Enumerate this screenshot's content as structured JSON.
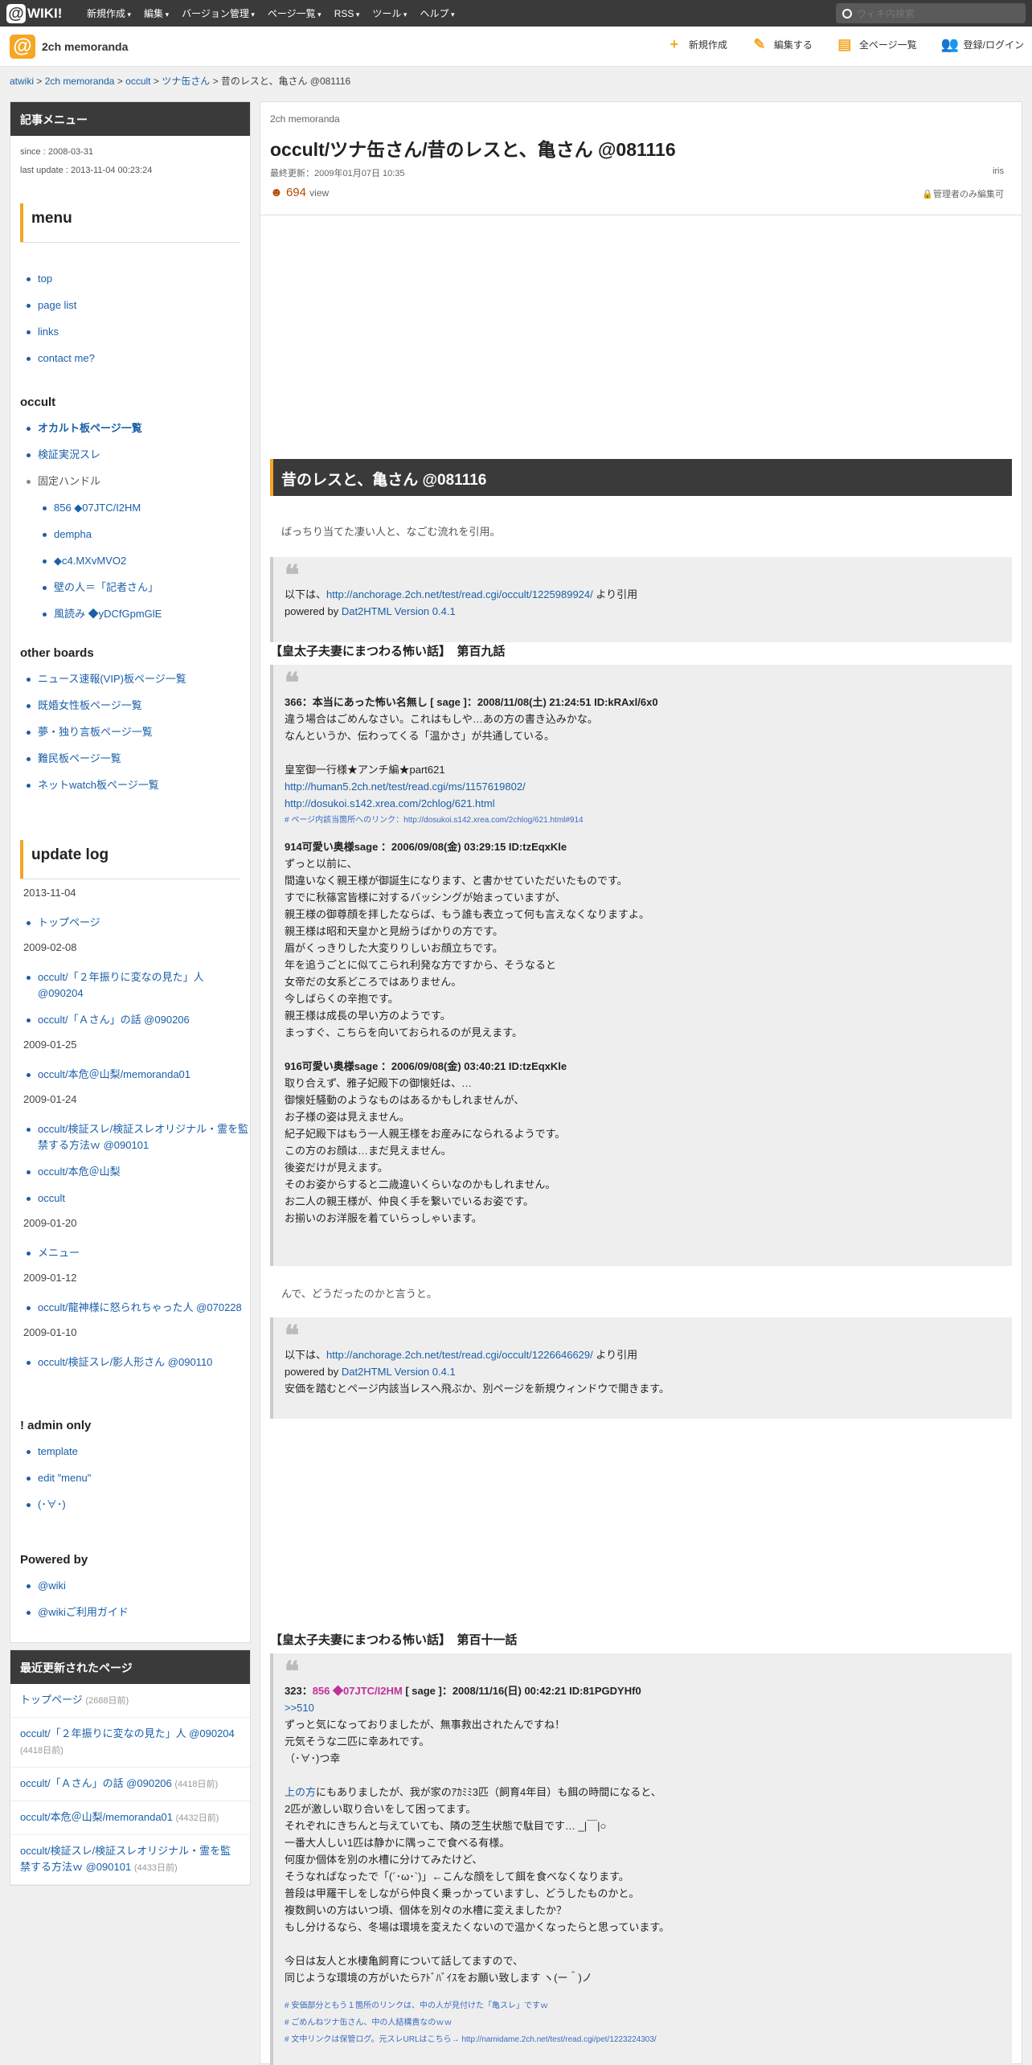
{
  "topbar": {
    "logo": "WIKI!",
    "menu": [
      "新規作成",
      "編集",
      "バージョン管理",
      "ページ一覧",
      "RSS",
      "ツール",
      "ヘルプ"
    ],
    "search_placeholder": "ウィキ内検索"
  },
  "header": {
    "site_name": "2ch memoranda",
    "actions": [
      "新規作成",
      "編集する",
      "全ページ一覧",
      "登録/ログイン"
    ]
  },
  "breadcrumb": {
    "items": [
      "atwiki",
      "2ch memoranda",
      "occult",
      "ツナ缶さん"
    ],
    "current": "昔のレスと、亀さん @081116",
    "sep": ">"
  },
  "sidebar": {
    "title": "記事メニュー",
    "since": "since : 2008-03-31",
    "last_update": "last update : 2013-11-04 00:23:24",
    "menu_title": "menu",
    "menu_items": [
      "top",
      "page list",
      "links",
      "contact me?"
    ],
    "occult_title": "occult",
    "occult_items": [
      "オカルト板ページ一覧",
      "検証実況スレ"
    ],
    "handles_title": "固定ハンドル",
    "handles": [
      "856 ◆07JTC/I2HM",
      "dempha",
      "◆c4.MXvMVO2",
      "壁の人＝「記者さん」",
      "風読み ◆yDCfGpmGlE"
    ],
    "other_title": "other boards",
    "other_items": [
      "ニュース速報(VIP)板ページ一覧",
      "既婚女性板ページ一覧",
      "夢・独り言板ページ一覧",
      "難民板ページ一覧",
      "ネットwatch板ページ一覧"
    ],
    "update_title": "update log",
    "updates": [
      {
        "date": "2013-11-04",
        "items": [
          "トップページ"
        ]
      },
      {
        "date": "2009-02-08",
        "items": [
          "occult/「２年振りに変なの見た」人 @090204",
          "occult/「Ａさん」の話 @090206"
        ]
      },
      {
        "date": "2009-01-25",
        "items": [
          "occult/本危＠山梨/memoranda01"
        ]
      },
      {
        "date": "2009-01-24",
        "items": [
          "occult/検証スレ/検証スレオリジナル・霊を監禁する方法ｗ @090101",
          "occult/本危＠山梨",
          "occult"
        ]
      },
      {
        "date": "2009-01-20",
        "items": [
          "メニュー"
        ]
      },
      {
        "date": "2009-01-12",
        "items": [
          "occult/龍神様に怒られちゃった人 @070228"
        ]
      },
      {
        "date": "2009-01-10",
        "items": [
          "occult/検証スレ/影人形さん @090110"
        ]
      }
    ],
    "admin_title": "! admin only",
    "admin_items": [
      "template",
      "edit \"menu\"",
      "(･∀･)"
    ],
    "powered_title": "Powered by",
    "powered_items": [
      "@wiki",
      "@wikiご利用ガイド"
    ]
  },
  "recent": {
    "title": "最近更新されたページ",
    "items": [
      {
        "label": "トップページ",
        "count": "(2688日前)"
      },
      {
        "label": "occult/「２年振りに変なの見た」人 @090204",
        "count": "(4418日前)"
      },
      {
        "label": "occult/「Ａさん」の話 @090206",
        "count": "(4418日前)"
      },
      {
        "label": "occult/本危＠山梨/memoranda01",
        "count": "(4432日前)"
      },
      {
        "label": "occult/検証スレ/検証スレオリジナル・霊を監禁する方法ｗ @090101",
        "count": "(4433日前)"
      }
    ]
  },
  "page": {
    "site": "2ch memoranda",
    "title": "occult/ツナ缶さん/昔のレスと、亀さん @081116",
    "updated": "最終更新：2009年01月07日 10:35",
    "author": "iris",
    "views": "694",
    "views_label": "view",
    "permission": "管理者のみ編集可",
    "section_title": "昔のレスと、亀さん @081116",
    "intro": "ばっちり当てた凄い人と、なごむ流れを引用。",
    "q1": {
      "prefix": "以下は、",
      "url": "http://anchorage.2ch.net/test/read.cgi/occult/1225989924/",
      "suffix": " より引用",
      "powered": "powered by ",
      "tool": "Dat2HTML Version 0.4.1"
    },
    "sub1": "【皇太子夫妻にまつわる怖い話】　第百九話",
    "q2": {
      "h1": "366：本当にあった怖い名無し [ sage ]：2008/11/08(土) 21:24:51 ID:kRAxl/6x0",
      "l1": [
        "違う場合はごめんなさい。これはもしや…あの方の書き込みかな。",
        "なんというか、伝わってくる「温かさ」が共通している。"
      ],
      "l2": "皇室御一行様★アンチ編★part621",
      "link1": "http://human5.2ch.net/test/read.cgi/ms/1157619802/",
      "link2": "http://dosukoi.s142.xrea.com/2chlog/621.html",
      "tiny1": "# ページ内該当箇所へのリンク：http://dosukoi.s142.xrea.com/2chlog/621.html#914",
      "h2": "914可愛い奥様sage ：2006/09/08(金) 03:29:15 ID:tzEqxKle",
      "l3": [
        "ずっと以前に、",
        "間違いなく親王様が御誕生になります、と書かせていただいたものです。",
        "すでに秋篠宮皆様に対するバッシングが始まっていますが、",
        "親王様の御尊顔を拝したならば、もう誰も表立って何も言えなくなりますよ。",
        "親王様は昭和天皇かと見紛うばかりの方です。",
        "眉がくっきりした大変りりしいお顔立ちです。",
        "年を追うごとに似てこられ利発な方ですから、そうなると",
        "女帝だの女系どころではありません。",
        "今しばらくの辛抱です。",
        "親王様は成長の早い方のようです。",
        "まっすぐ、こちらを向いておられるのが見えます。"
      ],
      "h3": "916可愛い奥様sage ：2006/09/08(金) 03:40:21 ID:tzEqxKle",
      "l4": [
        "取り合えず、雅子妃殿下の御懐妊は、…",
        "御懐妊騒動のようなものはあるかもしれませんが、",
        "お子様の姿は見えません。",
        "紀子妃殿下はもう一人親王様をお産みになられるようです。",
        "この方のお顔は…まだ見えません。",
        "後姿だけが見えます。",
        "そのお姿からすると二歳違いくらいなのかもしれません。",
        "お二人の親王様が、仲良く手を繋いでいるお姿です。",
        "お揃いのお洋服を着ていらっしゃいます。"
      ]
    },
    "mid": "んで、どうだったのかと言うと。",
    "q3": {
      "prefix": "以下は、",
      "url": "http://anchorage.2ch.net/test/read.cgi/occult/1226646629/",
      "suffix": " より引用",
      "powered": "powered by ",
      "tool": "Dat2HTML Version 0.4.1",
      "note": "安価を踏むとページ内該当レスへ飛ぶか、別ページを新規ウィンドウで開きます。"
    },
    "sub2": "【皇太子夫妻にまつわる怖い話】　第百十一話",
    "q4": {
      "num": "323：",
      "name": "856 ◆07JTC/I2HM",
      "rest": " [ sage ]：2008/11/16(日) 00:42:21 ID:81PGDYHf0",
      "anchor": ">>510",
      "l1": [
        "ずっと気になっておりましたが、無事救出されたんですね！",
        "元気そうな二匹に幸あれです。",
        "（･∀･)つ幸"
      ],
      "l2_link": "上の方",
      "l2_rest": "にもありましたが、我が家のｱｶﾐﾐ3匹（飼育4年目）も餌の時間になると、",
      "l3": [
        "2匹が激しい取り合いをして困ってます。",
        "それぞれにきちんと与えていても、隣の芝生状態で駄目です… _|￣|○",
        "一番大人しい1匹は静かに隅っこで食べる有様。",
        "何度か個体を別の水槽に分けてみたけど、",
        "そうなればなったで「(´･ω･`)」←こんな顔をして餌を食べなくなります。",
        "普段は甲羅干しをしながら仲良く乗っかっていますし、どうしたものかと。",
        "複数飼いの方はいつ頃、個体を別々の水槽に変えましたか？",
        "もし分けるなら、冬場は環境を変えたくないので温かくなったらと思っています。"
      ],
      "l4": [
        "今日は友人と水棲亀飼育について話してますので、",
        "同じような環境の方がいたらｱﾄﾞﾊﾞｲｽをお願い致します ヽ(ー＾)ノ"
      ],
      "tiny": [
        "# 安価部分ともう１箇所のリンクは、中の人が見付けた「亀スレ」ですｗ",
        "# ごめんねツナ缶さん、中の人結構貴なのｗｗ",
        "# 文中リンクは保管ログ。元スレURLはこちら→ http://namidame.2ch.net/test/read.cgi/pet/1223224303/"
      ]
    }
  }
}
